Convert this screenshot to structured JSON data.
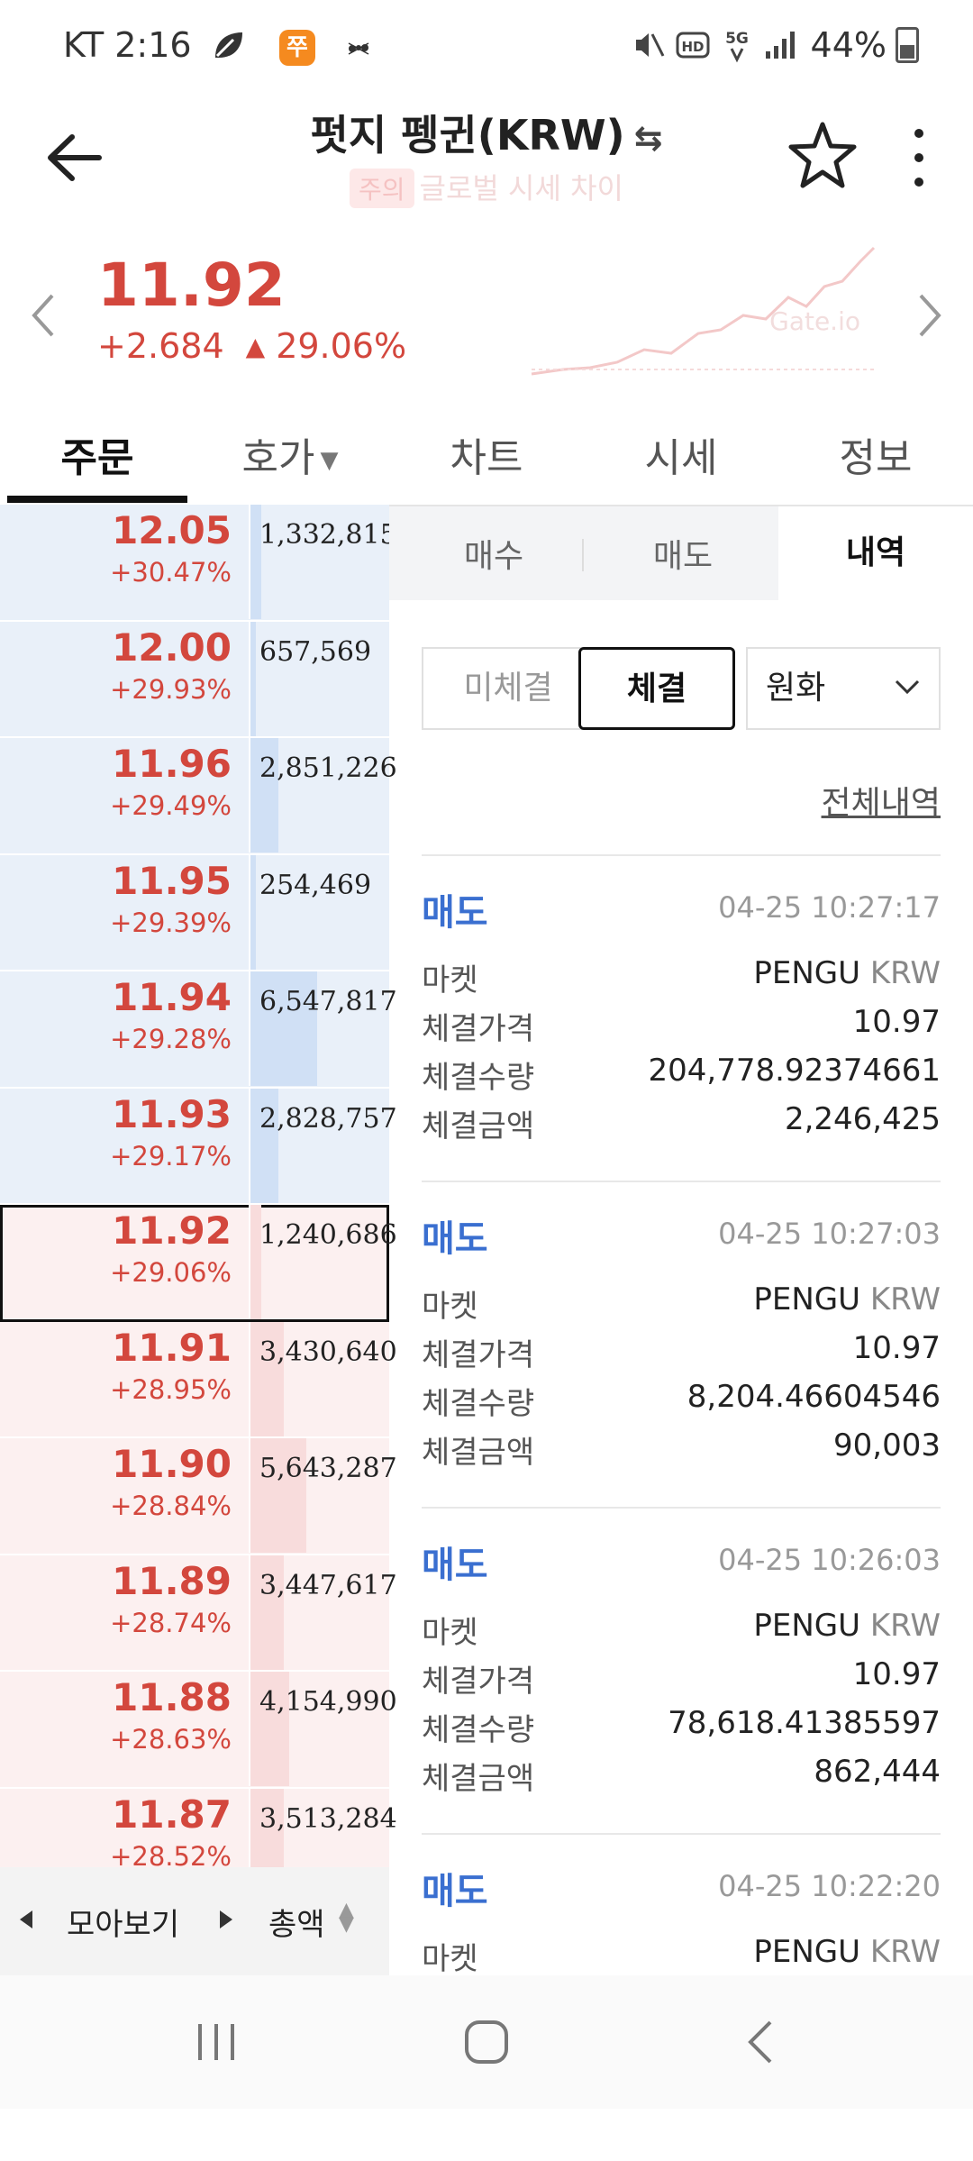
{
  "status": {
    "carrier_time": "KT 2:16",
    "app_badge": "쭈",
    "network": "5G",
    "battery": "44%"
  },
  "header": {
    "title": "펏지 펭귄(KRW)",
    "swap_glyph": "⇆",
    "notice_badge": "주의",
    "notice_text": "글로벌 시세 차이"
  },
  "price": {
    "current": "11.92",
    "change_abs": "+2.684",
    "change_pct": "29.06%",
    "watermark": "Gate.io"
  },
  "tabs": [
    {
      "label": "주문"
    },
    {
      "label": "호가"
    },
    {
      "label": "차트"
    },
    {
      "label": "시세"
    },
    {
      "label": "정보"
    }
  ],
  "orderbook": {
    "rows": [
      {
        "price": "12.05",
        "pct": "+30.47%",
        "qty": "1,332,815",
        "side": "ask",
        "fill": 0.02
      },
      {
        "price": "12.00",
        "pct": "+29.93%",
        "qty": "657,569",
        "side": "ask",
        "fill": 0.01
      },
      {
        "price": "11.96",
        "pct": "+29.49%",
        "qty": "2,851,226",
        "side": "ask",
        "fill": 0.05
      },
      {
        "price": "11.95",
        "pct": "+29.39%",
        "qty": "254,469",
        "side": "ask",
        "fill": 0.01
      },
      {
        "price": "11.94",
        "pct": "+29.28%",
        "qty": "6,547,817",
        "side": "ask",
        "fill": 0.12
      },
      {
        "price": "11.93",
        "pct": "+29.17%",
        "qty": "2,828,757",
        "side": "ask",
        "fill": 0.05
      },
      {
        "price": "11.92",
        "pct": "+29.06%",
        "qty": "1,240,686",
        "side": "bid",
        "fill": 0.02,
        "current": true
      },
      {
        "price": "11.91",
        "pct": "+28.95%",
        "qty": "3,430,640",
        "side": "bid",
        "fill": 0.06
      },
      {
        "price": "11.90",
        "pct": "+28.84%",
        "qty": "5,643,287",
        "side": "bid",
        "fill": 0.1
      },
      {
        "price": "11.89",
        "pct": "+28.74%",
        "qty": "3,447,617",
        "side": "bid",
        "fill": 0.06
      },
      {
        "price": "11.88",
        "pct": "+28.63%",
        "qty": "4,154,990",
        "side": "bid",
        "fill": 0.07
      },
      {
        "price": "11.87",
        "pct": "+28.52%",
        "qty": "3,513,284",
        "side": "bid",
        "fill": 0.06
      }
    ],
    "footer": {
      "group_label": "모아보기",
      "total_label": "총액"
    }
  },
  "panel": {
    "subtabs": [
      {
        "label": "매수"
      },
      {
        "label": "매도"
      },
      {
        "label": "내역"
      }
    ],
    "filters": {
      "pending": "미체결",
      "filled": "체결",
      "currency": "원화"
    },
    "all_link": "전체내역",
    "labels": {
      "market": "마켓",
      "price": "체결가격",
      "qty": "체결수량",
      "amount": "체결금액"
    },
    "trades": [
      {
        "side": "매도",
        "time": "04-25 10:27:17",
        "market_base": "PENGU",
        "market_quote": "KRW",
        "price": "10.97",
        "qty": "204,778.92374661",
        "amount": "2,246,425"
      },
      {
        "side": "매도",
        "time": "04-25 10:27:03",
        "market_base": "PENGU",
        "market_quote": "KRW",
        "price": "10.97",
        "qty": "8,204.46604546",
        "amount": "90,003"
      },
      {
        "side": "매도",
        "time": "04-25 10:26:03",
        "market_base": "PENGU",
        "market_quote": "KRW",
        "price": "10.97",
        "qty": "78,618.41385597",
        "amount": "862,444"
      },
      {
        "side": "매도",
        "time": "04-25 10:22:20",
        "market_base": "PENGU",
        "market_quote": "KRW"
      }
    ]
  },
  "colors": {
    "up": "#d3473d",
    "sell": "#3a6fd0",
    "ask_bg": "#e9f0f9",
    "bid_bg": "#fcf0f0"
  }
}
